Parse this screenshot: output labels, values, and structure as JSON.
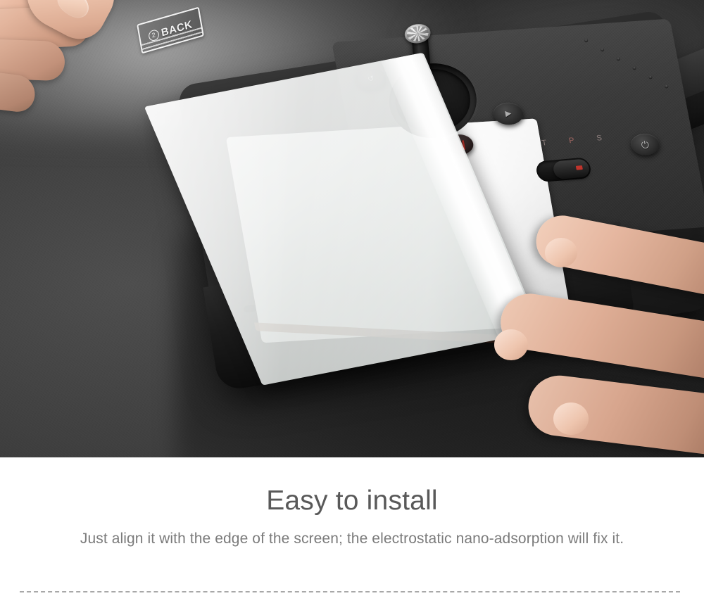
{
  "photo": {
    "alt": "Hand applying a screen protector film onto a DJI smart controller display",
    "film": {
      "tab_number": "2",
      "tab_label": "BACK"
    },
    "controller": {
      "buttons": [
        {
          "name": "return-button",
          "glyph": "↺"
        },
        {
          "name": "playback-button",
          "glyph": "▶"
        },
        {
          "name": "record-button",
          "glyph": "❙❙"
        },
        {
          "name": "power-button",
          "glyph": "⏻"
        }
      ],
      "mode_switch": {
        "labels": [
          "T",
          "P",
          "S"
        ],
        "selected": "P"
      }
    },
    "colors": {
      "desk": "#3f3f3f",
      "body": "#232323",
      "screen": "#f2f2f2",
      "film": "#eceeed",
      "accent_red": "#c0342c",
      "skin": "#e5b69f"
    }
  },
  "caption": {
    "title": "Easy to install",
    "subtitle": "Just align it with the edge of the screen; the electrostatic nano-adsorption will fix it.",
    "title_color": "#595959",
    "subtitle_color": "#7b7b7b",
    "divider_color": "#a8a8a8"
  }
}
